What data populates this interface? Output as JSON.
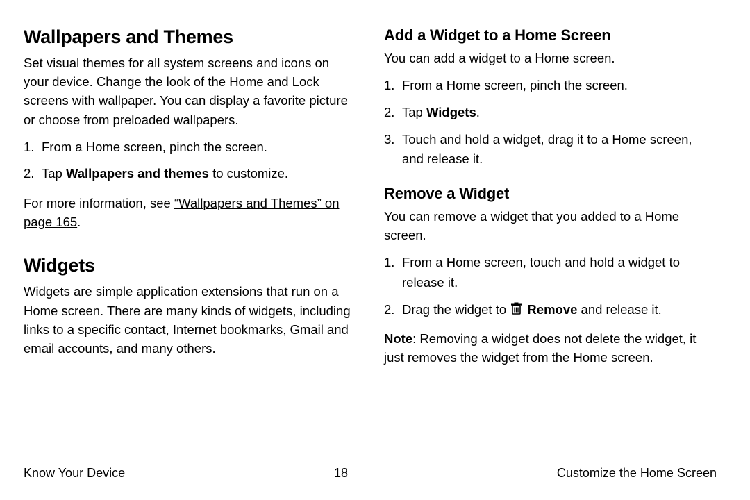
{
  "left": {
    "h_wallpapers": "Wallpapers and Themes",
    "p_wallpapers": "Set visual themes for all system screens and icons on your device. Change the look of the Home and Lock screens with wallpaper. You can display a favorite picture or choose from preloaded wallpapers.",
    "wp_step1": "From a Home screen, pinch the screen.",
    "wp_step2_pre": "Tap ",
    "wp_step2_bold": "Wallpapers and themes",
    "wp_step2_post": " to customize.",
    "xref_pre": "For more information, see ",
    "xref_link": "“Wallpapers and Themes” on page 165",
    "xref_post": ".",
    "h_widgets": "Widgets",
    "p_widgets": "Widgets are simple application extensions that run on a Home screen. There are many kinds of widgets, including links to a specific contact, Internet bookmarks, Gmail and email accounts, and many others."
  },
  "right": {
    "h_add": "Add a Widget to a Home Screen",
    "p_add": "You can add a widget to a Home screen.",
    "add_step1": "From a Home screen, pinch the screen.",
    "add_step2_pre": "Tap ",
    "add_step2_bold": "Widgets",
    "add_step2_post": ".",
    "add_step3": "Touch and hold a widget, drag it to a Home screen, and release it.",
    "h_remove": "Remove a Widget",
    "p_remove": "You can remove a widget that you added to a Home screen.",
    "rm_step1": "From a Home screen, touch and hold a widget to release it.",
    "rm_step2_pre": "Drag the widget to ",
    "rm_step2_bold": "Remove",
    "rm_step2_post": " and release it.",
    "note_label": "Note",
    "note_body": ": Removing a widget does not delete the widget, it just removes the widget from the Home screen."
  },
  "footer": {
    "left": "Know Your Device",
    "center": "18",
    "right": "Customize the Home Screen"
  }
}
